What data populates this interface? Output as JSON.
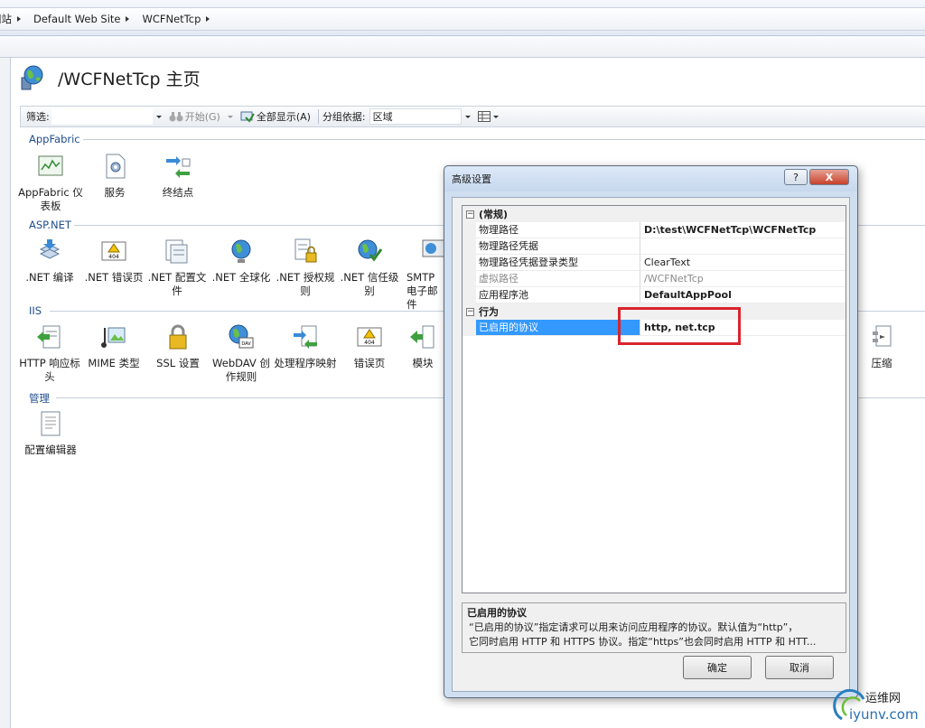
{
  "breadcrumb": {
    "items": [
      "网站",
      "Default Web Site",
      "WCFNetTcp"
    ]
  },
  "page": {
    "title": "/WCFNetTcp 主页"
  },
  "toolbar": {
    "filter_label": "筛选:",
    "filter_value": "",
    "go_label": "开始(G)",
    "show_all_label": "全部显示(A)",
    "group_by_label": "分组依据:",
    "group_by_value": "区域"
  },
  "sections": [
    {
      "title": "AppFabric",
      "features": [
        {
          "label": "AppFabric 仪表板",
          "icon": "dashboard-icon"
        },
        {
          "label": "服务",
          "icon": "services-icon"
        },
        {
          "label": "终结点",
          "icon": "endpoints-icon"
        }
      ]
    },
    {
      "title": "ASP.NET",
      "features": [
        {
          "label": ".NET 编译",
          "icon": "compile-icon"
        },
        {
          "label": ".NET 错误页",
          "icon": "error-page-icon"
        },
        {
          "label": ".NET 配置文件",
          "icon": "profile-icon"
        },
        {
          "label": ".NET 全球化",
          "icon": "globe-icon"
        },
        {
          "label": ".NET 授权规则",
          "icon": "authorization-icon"
        },
        {
          "label": ".NET 信任级别",
          "icon": "trust-level-icon"
        },
        {
          "label": "SMTP 电子邮件",
          "icon": "smtp-icon"
        }
      ]
    },
    {
      "title": "IIS",
      "features": [
        {
          "label": "HTTP 响应标头",
          "icon": "response-headers-icon"
        },
        {
          "label": "MIME 类型",
          "icon": "mime-icon"
        },
        {
          "label": "SSL 设置",
          "icon": "lock-icon"
        },
        {
          "label": "WebDAV 创作规则",
          "icon": "webdav-icon"
        },
        {
          "label": "处理程序映射",
          "icon": "handler-icon"
        },
        {
          "label": "错误页",
          "icon": "error-page-icon"
        },
        {
          "label": "模块",
          "icon": "modules-icon"
        },
        {
          "label": "压缩",
          "icon": "compression-icon"
        }
      ]
    },
    {
      "title": "管理",
      "features": [
        {
          "label": "配置编辑器",
          "icon": "config-editor-icon"
        }
      ]
    }
  ],
  "dialog": {
    "title": "高级设置",
    "help_label": "?",
    "close_label": "X",
    "categories": [
      {
        "name": "(常规)",
        "toggle": "−",
        "rows": [
          {
            "name": "物理路径",
            "value": "D:\\test\\WCFNetTcp\\WCFNetTcp"
          },
          {
            "name": "物理路径凭据",
            "value": ""
          },
          {
            "name": "物理路径凭据登录类型",
            "value": "ClearText"
          },
          {
            "name": "虚拟路径",
            "value": "/WCFNetTcp"
          },
          {
            "name": "应用程序池",
            "value": "DefaultAppPool"
          }
        ]
      },
      {
        "name": "行为",
        "toggle": "−",
        "rows": [
          {
            "name": "已启用的协议",
            "value": "http, net.tcp"
          }
        ]
      }
    ],
    "description": {
      "title": "已启用的协议",
      "line1": "“已启用的协议”指定请求可以用来访问应用程序的协议。默认值为“http”，",
      "line2": "它同时启用 HTTP 和 HTTPS 协议。指定“https”也会同时启用 HTTP 和 HTT..."
    },
    "ok_label": "确定",
    "cancel_label": "取消"
  },
  "watermark": {
    "cn": "运维网",
    "domain": "iyunv.com"
  },
  "colors": {
    "accent": "#3399ff",
    "highlight": "#d8242c",
    "section_title": "#1d4c8d"
  }
}
